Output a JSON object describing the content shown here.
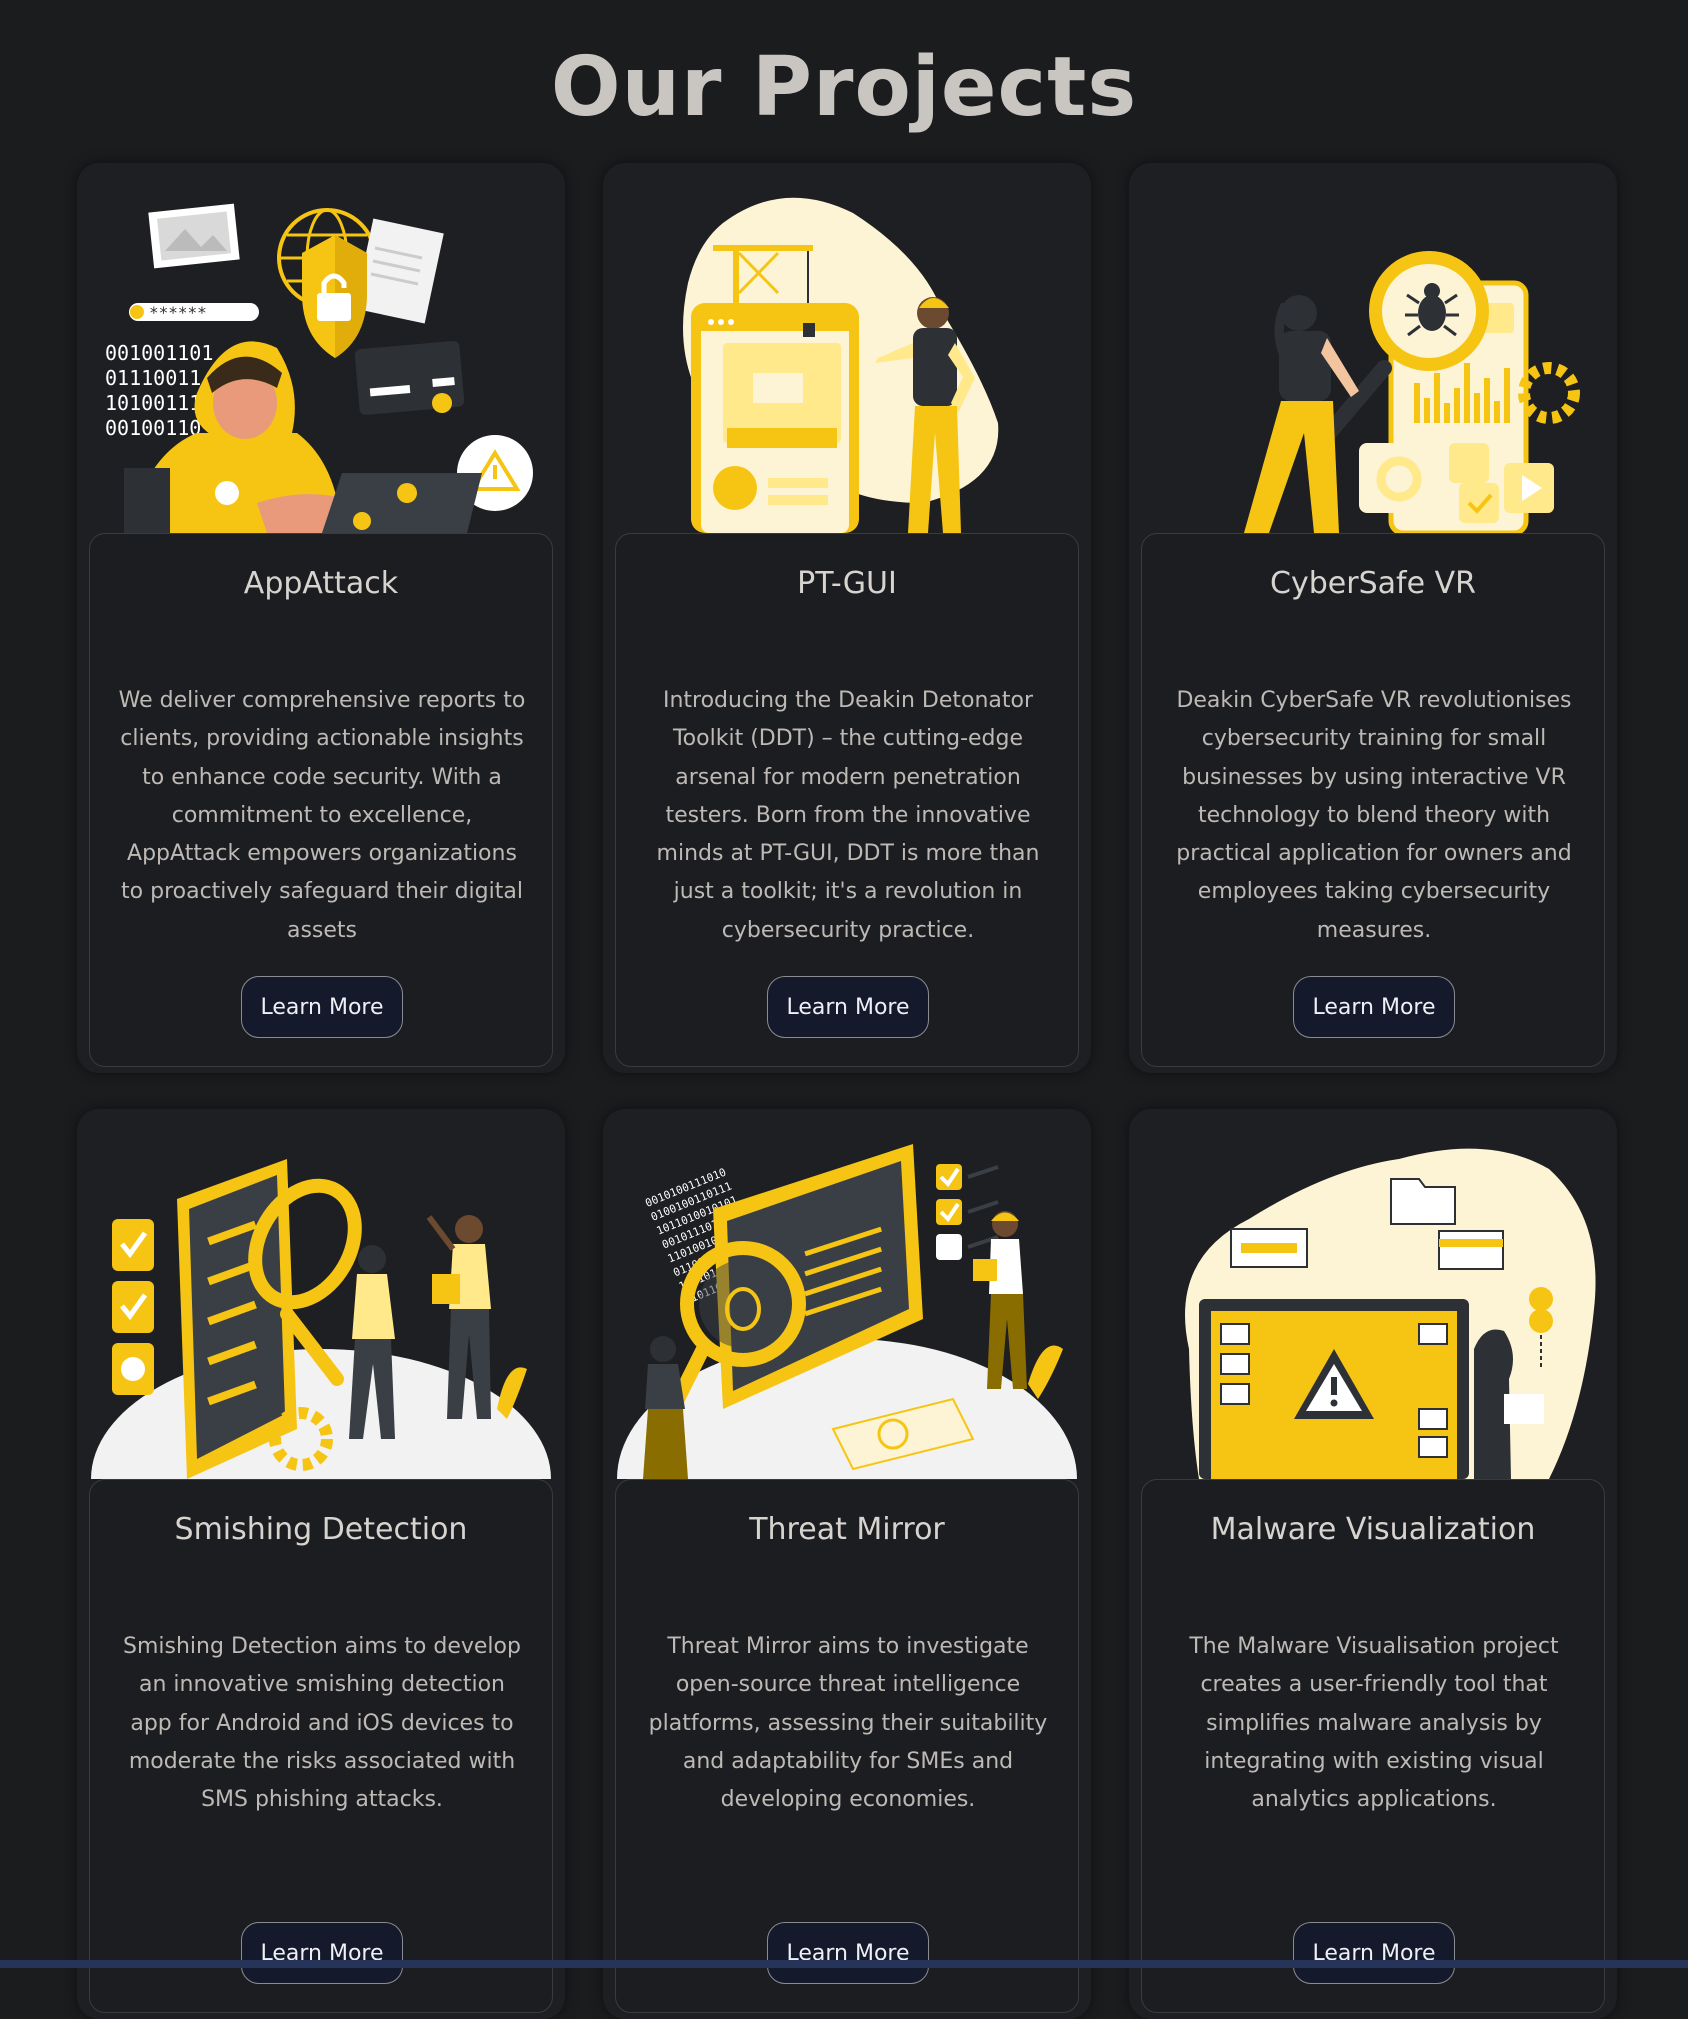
{
  "page": {
    "title": "Our Projects"
  },
  "colors": {
    "accent": "#f6c514",
    "background": "#1b1c1e",
    "button_bg": "#141a2c"
  },
  "projects": [
    {
      "title": "AppAttack",
      "description": "We deliver comprehensive reports to clients, providing actionable insights to enhance code security. With a commitment to excellence, AppAttack empowers organizations to proactively safeguard their digital assets",
      "button_label": "Learn More",
      "image_icon": "hacker-security-illustration",
      "image_text": [
        "001001101",
        "01110011",
        "10100111",
        "00100110",
        "******"
      ]
    },
    {
      "title": "PT-GUI",
      "description": "Introducing the Deakin Detonator Toolkit (DDT) – the cutting-edge arsenal for modern penetration testers. Born from the innovative minds at PT-GUI, DDT is more than just a toolkit; it's a revolution in cybersecurity practice.",
      "button_label": "Learn More",
      "image_icon": "construction-app-illustration"
    },
    {
      "title": "CyberSafe VR",
      "description": "Deakin CyberSafe VR revolutionises cybersecurity training for small businesses by using interactive VR technology to blend theory with practical application for owners and employees taking cybersecurity measures.",
      "button_label": "Learn More",
      "image_icon": "bug-magnifier-illustration"
    },
    {
      "title": "Smishing Detection",
      "description": "Smishing Detection aims to develop an innovative smishing detection app for Android and iOS devices to moderate the risks associated with SMS phishing attacks.",
      "button_label": "Learn More",
      "image_icon": "phone-inspection-illustration"
    },
    {
      "title": "Threat Mirror",
      "description": "Threat Mirror aims to investigate open-source threat intelligence platforms, assessing their suitability and adaptability for SMEs and developing economies.",
      "button_label": "Learn More",
      "image_icon": "threat-analysis-illustration"
    },
    {
      "title": "Malware Visualization",
      "description": "The Malware Visualisation project creates a user-friendly tool that simplifies malware analysis by integrating with existing visual analytics applications.",
      "button_label": "Learn More",
      "image_icon": "malware-warning-illustration"
    }
  ]
}
